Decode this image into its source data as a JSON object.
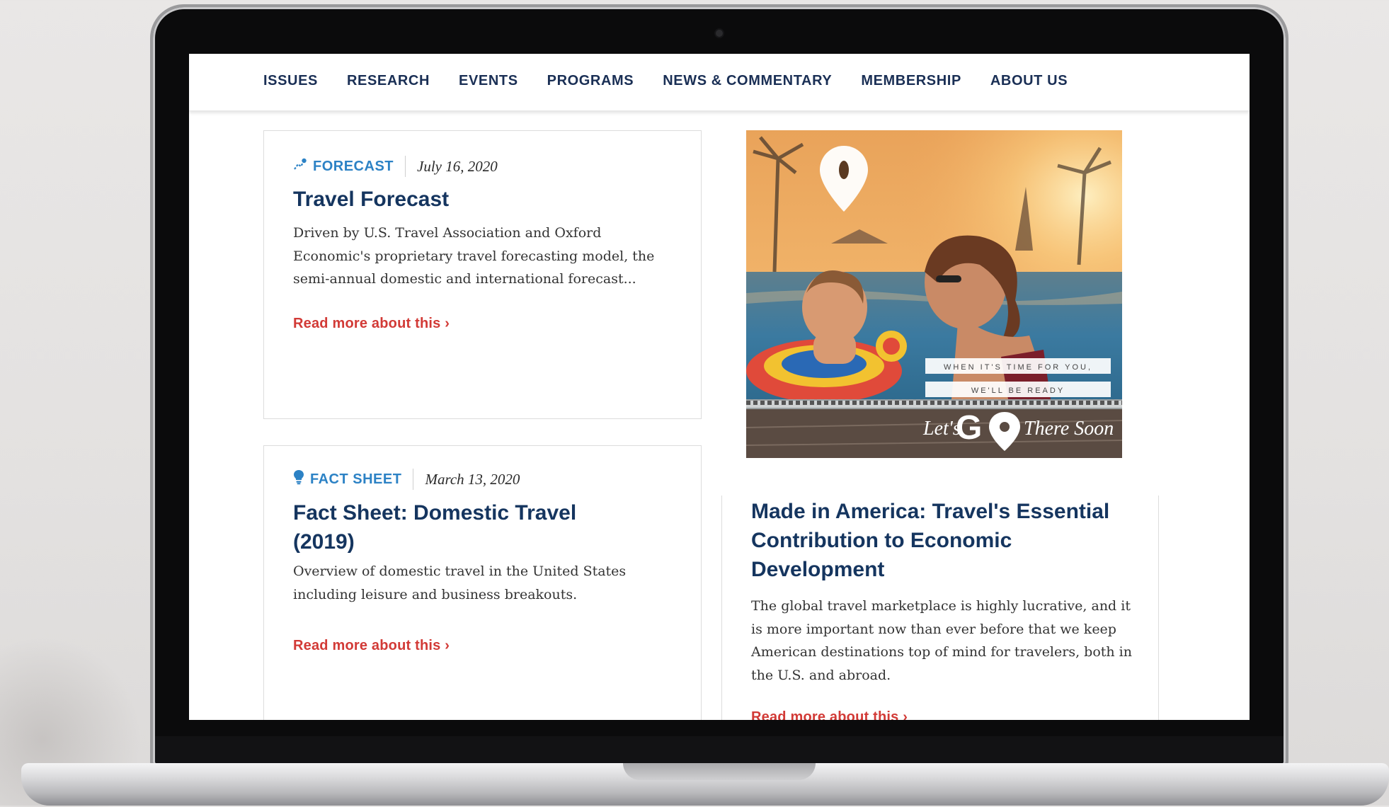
{
  "nav": {
    "items": [
      "ISSUES",
      "RESEARCH",
      "EVENTS",
      "PROGRAMS",
      "NEWS & COMMENTARY",
      "MEMBERSHIP",
      "ABOUT US"
    ]
  },
  "cards": [
    {
      "type": "FORECAST",
      "icon": "chart-trend-icon",
      "date": "July 16, 2020",
      "title": "Travel Forecast",
      "description": "Driven by U.S. Travel Association and Oxford Economic's proprietary travel forecasting model, the semi-annual domestic and international forecast...",
      "link": "Read more about this ›"
    },
    {
      "type": "FACT SHEET",
      "icon": "lightbulb-icon",
      "date": "March 13, 2020",
      "title": "Fact Sheet: Domestic Travel (2019)",
      "description": "Overview of domestic travel in the United States including leisure and business breakouts.",
      "link": "Read more about this ›"
    },
    {
      "title": "Made in America: Travel's Essential Contribution to Economic Development",
      "description": "The global travel marketplace is highly lucrative, and it is more important now than ever before that we keep American destinations top of mind for travelers, both in the U.S. and abroad.",
      "link": "Read more about this ›"
    }
  ],
  "promo": {
    "line1": "WHEN IT'S TIME FOR YOU,",
    "line2": "WE'LL BE READY",
    "lets": "Let's",
    "go": "G",
    "there_soon": "There Soon"
  },
  "colors": {
    "nav_text": "#1a2f55",
    "type_label": "#2c82c5",
    "title": "#15355f",
    "link": "#d23a36"
  }
}
